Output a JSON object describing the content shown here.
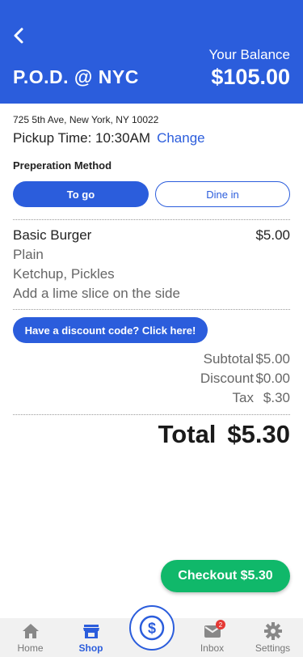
{
  "header": {
    "store_name": "P.O.D. @ NYC",
    "balance_label": "Your Balance",
    "balance_value": "$105.00"
  },
  "order": {
    "address": "725 5th Ave, New York, NY 10022",
    "pickup_text": "Pickup Time: 10:30AM",
    "change_label": "Change",
    "prep_label": "Preperation Method",
    "prep_options": [
      "To go",
      "Dine in"
    ],
    "prep_selected": "To go"
  },
  "item": {
    "name": "Basic Burger",
    "price": "$5.00",
    "modifiers": [
      "Plain",
      "Ketchup, Pickles",
      "Add a lime slice on the side"
    ]
  },
  "discount_label": "Have a discount code? Click here!",
  "summary": {
    "subtotal_label": "Subtotal",
    "subtotal_value": "$5.00",
    "discount_label": "Discount",
    "discount_value": "$0.00",
    "tax_label": "Tax",
    "tax_value": "$.30",
    "total_label": "Total",
    "total_value": "$5.30"
  },
  "checkout_label": "Checkout $5.30",
  "tabbar": {
    "tabs": [
      {
        "label": "Home",
        "icon": "home-icon"
      },
      {
        "label": "Shop",
        "icon": "store-icon"
      },
      {
        "label": "Inbox",
        "icon": "mail-icon",
        "badge": "2"
      },
      {
        "label": "Settings",
        "icon": "gear-icon"
      }
    ],
    "active": "Shop",
    "center_icon": "dollar-icon"
  },
  "colors": {
    "brand": "#2b5ddc",
    "checkout": "#10b86a",
    "badge": "#e53935"
  }
}
